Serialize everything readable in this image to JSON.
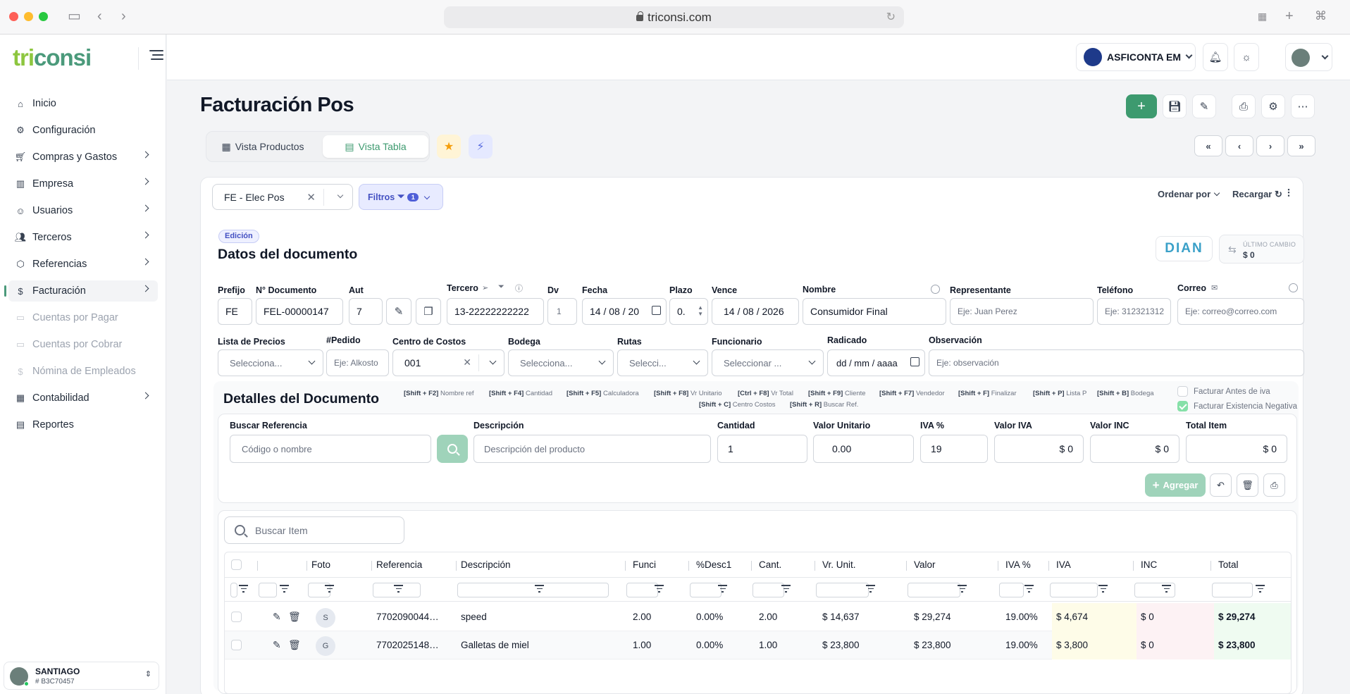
{
  "browser": {
    "url": "triconsi.com"
  },
  "sidebar": {
    "logo": {
      "part1": "tri",
      "part2": "consi"
    },
    "items": [
      {
        "label": "Inicio",
        "icon": "home-icon",
        "chevron": false,
        "state": "normal"
      },
      {
        "label": "Configuración",
        "icon": "gear-icon",
        "chevron": false,
        "state": "normal"
      },
      {
        "label": "Compras y Gastos",
        "icon": "cart-icon",
        "chevron": true,
        "state": "normal"
      },
      {
        "label": "Empresa",
        "icon": "building-icon",
        "chevron": true,
        "state": "normal"
      },
      {
        "label": "Usuarios",
        "icon": "user-scan-icon",
        "chevron": true,
        "state": "normal"
      },
      {
        "label": "Terceros",
        "icon": "users-icon",
        "chevron": true,
        "state": "normal"
      },
      {
        "label": "Referencias",
        "icon": "box-icon",
        "chevron": true,
        "state": "normal"
      },
      {
        "label": "Facturación",
        "icon": "dollar-circle-icon",
        "chevron": true,
        "state": "active"
      },
      {
        "label": "Cuentas por Pagar",
        "icon": "wallet-icon",
        "chevron": false,
        "state": "disabled"
      },
      {
        "label": "Cuentas por Cobrar",
        "icon": "wallet-icon",
        "chevron": false,
        "state": "disabled"
      },
      {
        "label": "Nómina de Empleados",
        "icon": "dollar-icon",
        "chevron": false,
        "state": "disabled"
      },
      {
        "label": "Contabilidad",
        "icon": "calculator-icon",
        "chevron": true,
        "state": "normal"
      },
      {
        "label": "Reportes",
        "icon": "report-icon",
        "chevron": false,
        "state": "normal"
      }
    ],
    "user": {
      "name": "SANTIAGO",
      "id": "# B3C70457"
    }
  },
  "header": {
    "company": "ASFICONTA EM"
  },
  "page": {
    "title": "Facturación Pos",
    "view_tabs": [
      "Vista Productos",
      "Vista Tabla"
    ],
    "series": "FE - Elec Pos",
    "filters_label": "Filtros",
    "filters_count": "1",
    "order_label": "Ordenar por",
    "reload_label": "Recargar"
  },
  "document": {
    "badge": "Edición",
    "title": "Datos del documento",
    "dian": "DIAN",
    "last_change_label": "ÚLTIMO CAMBIO",
    "last_change_value": "$ 0",
    "labels": {
      "prefijo": "Prefijo",
      "numero": "N° Documento",
      "aut": "Aut",
      "tercero": "Tercero",
      "dv": "Dv",
      "fecha": "Fecha",
      "plazo": "Plazo",
      "vence": "Vence",
      "nombre": "Nombre",
      "representante": "Representante",
      "telefono": "Teléfono",
      "correo": "Correo",
      "lista_precios": "Lista de Precios",
      "pedido": "#Pedido",
      "centro_costos": "Centro de Costos",
      "bodega": "Bodega",
      "rutas": "Rutas",
      "funcionario": "Funcionario",
      "radicado": "Radicado",
      "observacion": "Observación"
    },
    "values": {
      "prefijo": "FE",
      "numero": "FEL-00000147",
      "aut": "7",
      "tercero": "13-22222222222",
      "dv": "1",
      "fecha": "14 / 08 / 20",
      "plazo": "0.",
      "vence": "14 / 08 / 2026",
      "nombre": "Consumidor Final",
      "centro_costos": "001"
    },
    "placeholders": {
      "representante": "Eje: Juan Perez",
      "telefono": "Eje: 312321312",
      "correo": "Eje: correo@correo.com",
      "lista_precios": "Selecciona...",
      "pedido": "Eje: Alkosto",
      "bodega": "Selecciona...",
      "rutas": "Selecci...",
      "funcionario": "Seleccionar ...",
      "radicado": "dd / mm / aaaa",
      "observacion": "Eje: observación"
    }
  },
  "details": {
    "title": "Detalles del Documento",
    "shortcuts_line1": [
      {
        "key": "[Shift + F2]",
        "desc": "Nombre ref"
      },
      {
        "key": "[Shift + F4]",
        "desc": "Cantidad"
      },
      {
        "key": "[Shift + F5]",
        "desc": "Calculadora"
      },
      {
        "key": "[Shift + F8]",
        "desc": "Vr Unitario"
      },
      {
        "key": "[Ctrl + F8]",
        "desc": "Vr Total"
      },
      {
        "key": "[Shift + F9]",
        "desc": "Cliente"
      },
      {
        "key": "[Shift + F7]",
        "desc": "Vendedor"
      },
      {
        "key": "[Shift + F]",
        "desc": "Finalizar"
      },
      {
        "key": "[Shift + P]",
        "desc": "Lista P"
      },
      {
        "key": "[Shift + B]",
        "desc": "Bodega"
      }
    ],
    "shortcuts_line2": [
      {
        "key": "[Shift + C]",
        "desc": "Centro Costos"
      },
      {
        "key": "[Shift + R]",
        "desc": "Buscar Ref."
      }
    ],
    "check_antes_iva": "Facturar Antes de iva",
    "check_existencia": "Facturar Existencia Negativa",
    "labels": {
      "buscar": "Buscar Referencia",
      "descripcion": "Descripción",
      "cantidad": "Cantidad",
      "valor_unitario": "Valor Unitario",
      "iva_pct": "IVA %",
      "valor_iva": "Valor IVA",
      "valor_inc": "Valor INC",
      "total_item": "Total Item"
    },
    "placeholders": {
      "buscar": "Código o nombre",
      "descripcion": "Descripción del producto"
    },
    "values": {
      "cantidad": "1",
      "valor_unitario": "0.00",
      "iva_pct": "19",
      "valor_iva": "$ 0",
      "valor_inc": "$ 0",
      "total_item": "$ 0"
    },
    "add_label": "Agregar"
  },
  "table": {
    "search_placeholder": "Buscar Item",
    "columns": [
      "Foto",
      "Referencia",
      "Descripción",
      "Funci",
      "%Desc1",
      "Cant.",
      "Vr. Unit.",
      "Valor",
      "IVA %",
      "IVA",
      "INC",
      "Total"
    ],
    "rows": [
      {
        "foto": "S",
        "referencia": "77020900441...",
        "descripcion": "speed",
        "funci": "2.00",
        "desc1": "0.00%",
        "cant": "2.00",
        "vr_unit": "$ 14,637",
        "valor": "$ 29,274",
        "iva_pct": "19.00%",
        "iva": "$ 4,674",
        "inc": "$ 0",
        "total": "$ 29,274"
      },
      {
        "foto": "G",
        "referencia": "77020251484...",
        "descripcion": "Galletas de miel",
        "funci": "1.00",
        "desc1": "0.00%",
        "cant": "1.00",
        "vr_unit": "$ 23,800",
        "valor": "$ 23,800",
        "iva_pct": "19.00%",
        "iva": "$ 3,800",
        "inc": "$ 0",
        "total": "$ 23,800"
      }
    ]
  },
  "colors": {
    "brand": "#3d9a6f",
    "filters": "#4350c2",
    "dian": "#3aa0c8"
  }
}
